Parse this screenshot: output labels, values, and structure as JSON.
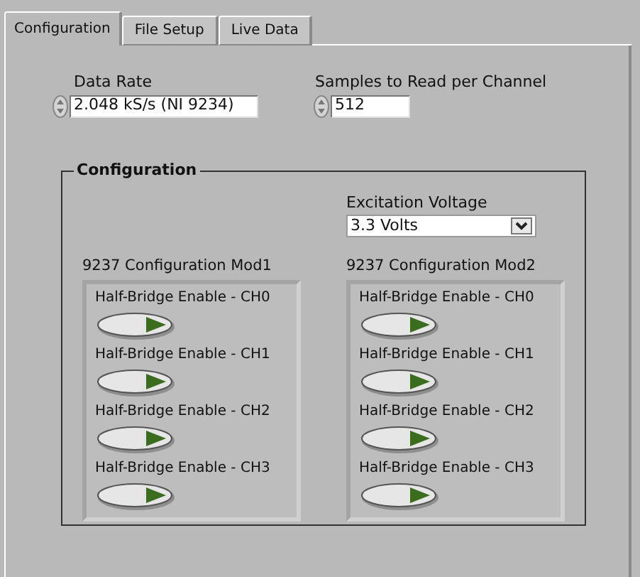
{
  "tabs": [
    {
      "label": "Configuration",
      "selected": true
    },
    {
      "label": "File Setup",
      "selected": false
    },
    {
      "label": "Live Data",
      "selected": false
    }
  ],
  "data_rate": {
    "label": "Data Rate",
    "value": "2.048 kS/s (NI 9234)"
  },
  "samples": {
    "label": "Samples to Read per Channel",
    "value": "512"
  },
  "group": {
    "title": "Configuration",
    "excitation": {
      "label": "Excitation Voltage",
      "value": "3.3 Volts"
    },
    "modules": [
      {
        "title": "9237 Configuration Mod1",
        "switches": [
          {
            "label": "Half-Bridge Enable - CH0",
            "on": false
          },
          {
            "label": "Half-Bridge Enable - CH1",
            "on": false
          },
          {
            "label": "Half-Bridge Enable - CH2",
            "on": false
          },
          {
            "label": "Half-Bridge Enable - CH3",
            "on": false
          }
        ]
      },
      {
        "title": "9237 Configuration Mod2",
        "switches": [
          {
            "label": "Half-Bridge Enable - CH0",
            "on": false
          },
          {
            "label": "Half-Bridge Enable - CH1",
            "on": false
          },
          {
            "label": "Half-Bridge Enable - CH2",
            "on": false
          },
          {
            "label": "Half-Bridge Enable - CH3",
            "on": false
          }
        ]
      }
    ]
  }
}
